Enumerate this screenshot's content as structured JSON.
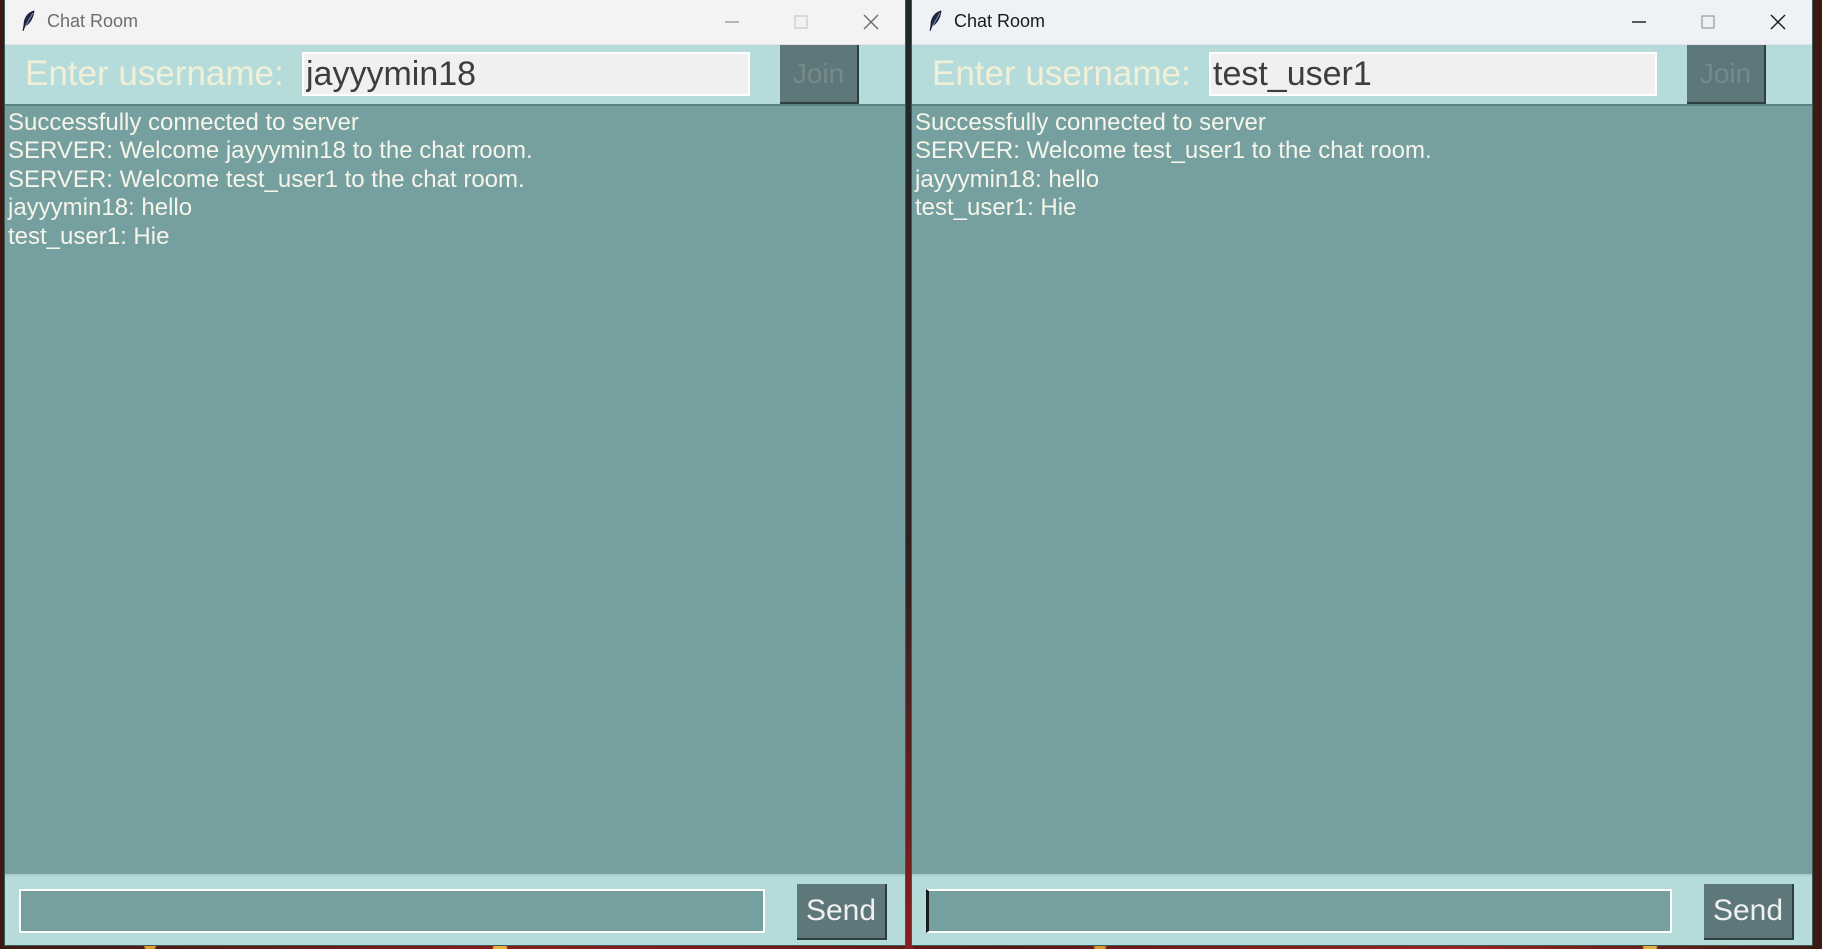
{
  "windows": [
    {
      "title": "Chat Room",
      "username_label": "Enter username:",
      "username_value": "jayyymin18",
      "join_label": "Join",
      "send_label": "Send",
      "messages": [
        "Successfully connected to server",
        "SERVER:  Welcome jayyymin18 to the chat room.",
        "SERVER:  Welcome test_user1 to the chat room.",
        "jayyymin18:  hello",
        "test_user1:  Hie"
      ]
    },
    {
      "title": "Chat Room",
      "username_label": "Enter username:",
      "username_value": "test_user1",
      "join_label": "Join",
      "send_label": "Send",
      "messages": [
        "Successfully connected to server",
        "SERVER:  Welcome test_user1 to the chat room.",
        "jayyymin18:  hello",
        "test_user1:  Hie"
      ]
    }
  ],
  "icons": {
    "app": "feather-icon",
    "minimize": "minimize-icon",
    "maximize": "maximize-icon",
    "close": "close-icon"
  },
  "colors": {
    "chat_bg": "#769fa0",
    "bar_bg": "#b5dcdb",
    "button_bg": "#5d777a",
    "label_text": "#f0f0d8"
  }
}
